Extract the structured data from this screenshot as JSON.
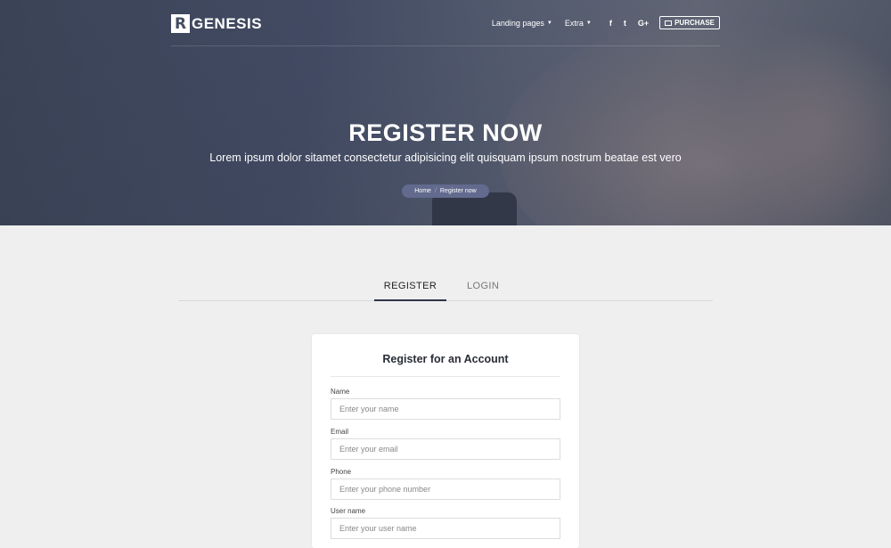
{
  "brand": {
    "mark": "R",
    "name": "GENESIS"
  },
  "nav": {
    "links": [
      {
        "label": "Landing pages"
      },
      {
        "label": "Extra"
      }
    ],
    "social": {
      "facebook": "f",
      "twitter": "t",
      "google": "G+"
    },
    "purchase_label": "PURCHASE"
  },
  "hero": {
    "title": "REGISTER NOW",
    "subtitle": "Lorem ipsum dolor sitamet consectetur adipisicing elit quisquam ipsum nostrum beatae est vero",
    "breadcrumb": {
      "home": "Home",
      "separator": "/",
      "current": "Register now"
    }
  },
  "tabs": {
    "register": "REGISTER",
    "login": "LOGIN"
  },
  "form": {
    "title": "Register for an Account",
    "fields": [
      {
        "label": "Name",
        "placeholder": "Enter your name"
      },
      {
        "label": "Email",
        "placeholder": "Enter your email"
      },
      {
        "label": "Phone",
        "placeholder": "Enter your phone number"
      },
      {
        "label": "User name",
        "placeholder": "Enter your user name"
      }
    ]
  },
  "colors": {
    "hero_overlay": "#454d62",
    "breadcrumb_bg": "#626a8e",
    "page_bg": "#efefef",
    "tab_active_border": "#2f3447"
  }
}
